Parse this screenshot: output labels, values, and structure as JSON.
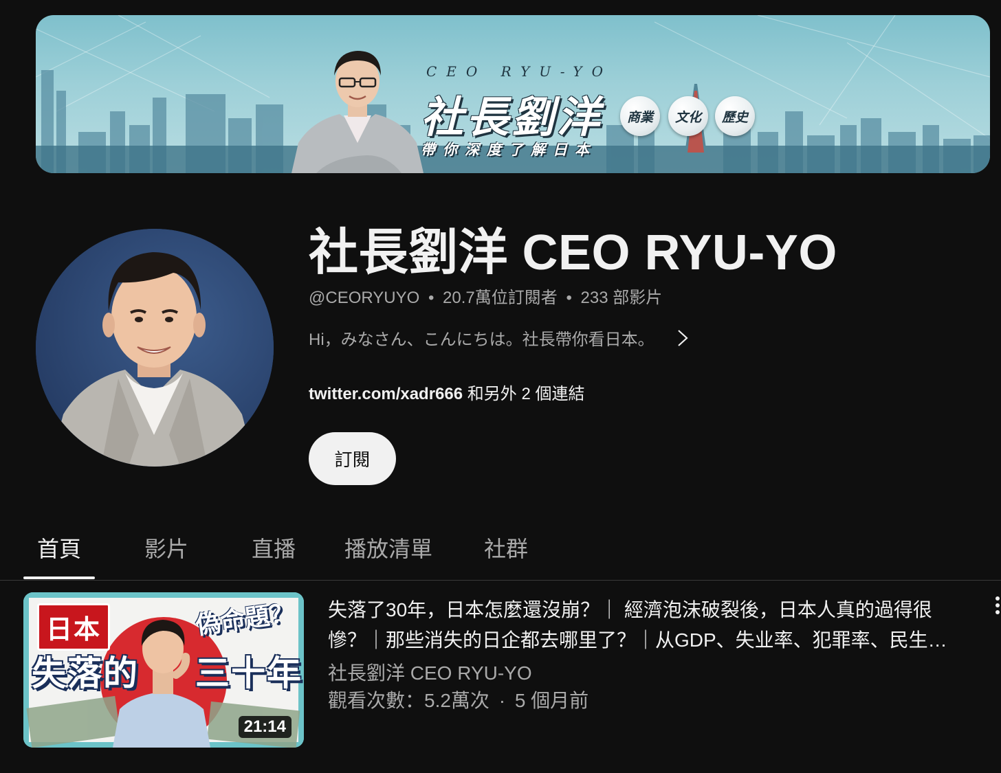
{
  "banner": {
    "ceo_line": "CEO RYU-YO",
    "big_title": "社長劉洋",
    "sub_title": "帶你深度了解日本",
    "bubbles": [
      "商業",
      "文化",
      "歷史"
    ]
  },
  "channel": {
    "name": "社長劉洋 CEO RYU-YO",
    "handle": "@CEORYUYO",
    "subscribers": "20.7萬位訂閱者",
    "video_count": "233 部影片",
    "separator": "•",
    "description": "Hi，みなさん、こんにちは。社長帶你看日本。",
    "link": "twitter.com/xadr666",
    "more_links": "和另外 2 個連結",
    "subscribe_label": "訂閱"
  },
  "tabs": [
    {
      "label": "首頁",
      "active": true
    },
    {
      "label": "影片",
      "active": false
    },
    {
      "label": "直播",
      "active": false
    },
    {
      "label": "播放清單",
      "active": false
    },
    {
      "label": "社群",
      "active": false
    }
  ],
  "featured": {
    "thumbnail": {
      "tag": "日本",
      "text_left": "失落的",
      "text_right": "三十年",
      "text_top": "偽命題？",
      "duration": "21:14"
    },
    "title": "失落了30年，日本怎麼還沒崩？｜ 經濟泡沫破裂後，日本人真的過得很慘？｜那些消失的日企都去哪里了？｜从GDP、失业率、犯罪率、民生…",
    "channel": "社長劉洋 CEO RYU-YO",
    "views": "觀看次數：5.2萬次",
    "dot": "·",
    "age": "5 個月前"
  },
  "colors": {
    "background": "#0f0f0f",
    "text_primary": "#f1f1f1",
    "text_secondary": "#aaaaaa",
    "subscribe_bg": "#f1f1f1"
  },
  "icons": {
    "description_more": "chevron-right-icon",
    "video_menu": "more-vert-icon"
  }
}
